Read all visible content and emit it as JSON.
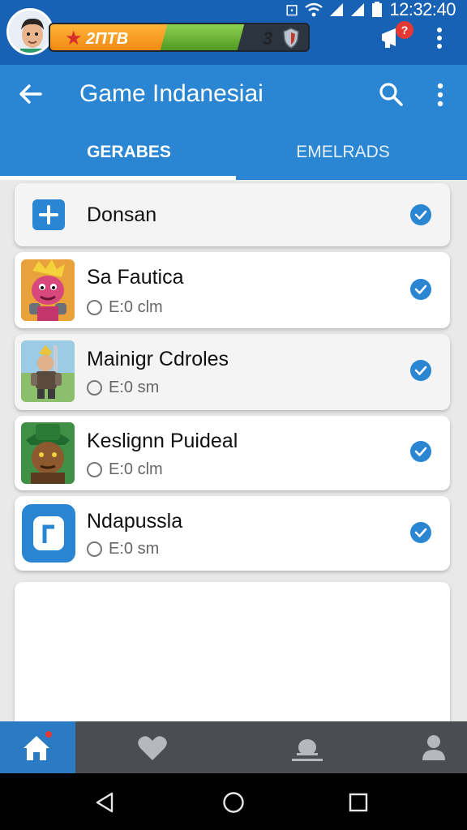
{
  "status": {
    "level_label": "2ПТВ",
    "level_number": "3",
    "time": "12:32:40",
    "notification_badge": "?"
  },
  "appbar": {
    "title": "Game Indanesiai",
    "tabs": [
      {
        "label": "GERABES",
        "active": true
      },
      {
        "label": "EMELRADS",
        "active": false
      }
    ]
  },
  "list": {
    "header_item": {
      "label": "Donsan",
      "checked": true
    },
    "items": [
      {
        "title": "Sa Fautica",
        "meta": "E:0 clm",
        "icon": "monster-app-icon",
        "checked": true
      },
      {
        "title": "Mainigr Cdroles",
        "meta": "E:0 sm",
        "icon": "warrior-app-icon",
        "checked": true
      },
      {
        "title": "Keslignn Puideal",
        "meta": "E:0 clm",
        "icon": "goblin-app-icon",
        "checked": true
      },
      {
        "title": "Ndapussla",
        "meta": "E:0 sm",
        "icon": "blue-square-app-icon",
        "checked": true
      }
    ]
  },
  "bottom_nav": [
    "home-icon",
    "heart-icon",
    "person-badge-icon",
    "profile-icon"
  ],
  "system_nav": [
    "back-icon",
    "home-circle-icon",
    "recents-icon"
  ],
  "colors": {
    "primary": "#2a85d2",
    "dark_primary": "#1762b5",
    "check": "#2a85d2"
  }
}
